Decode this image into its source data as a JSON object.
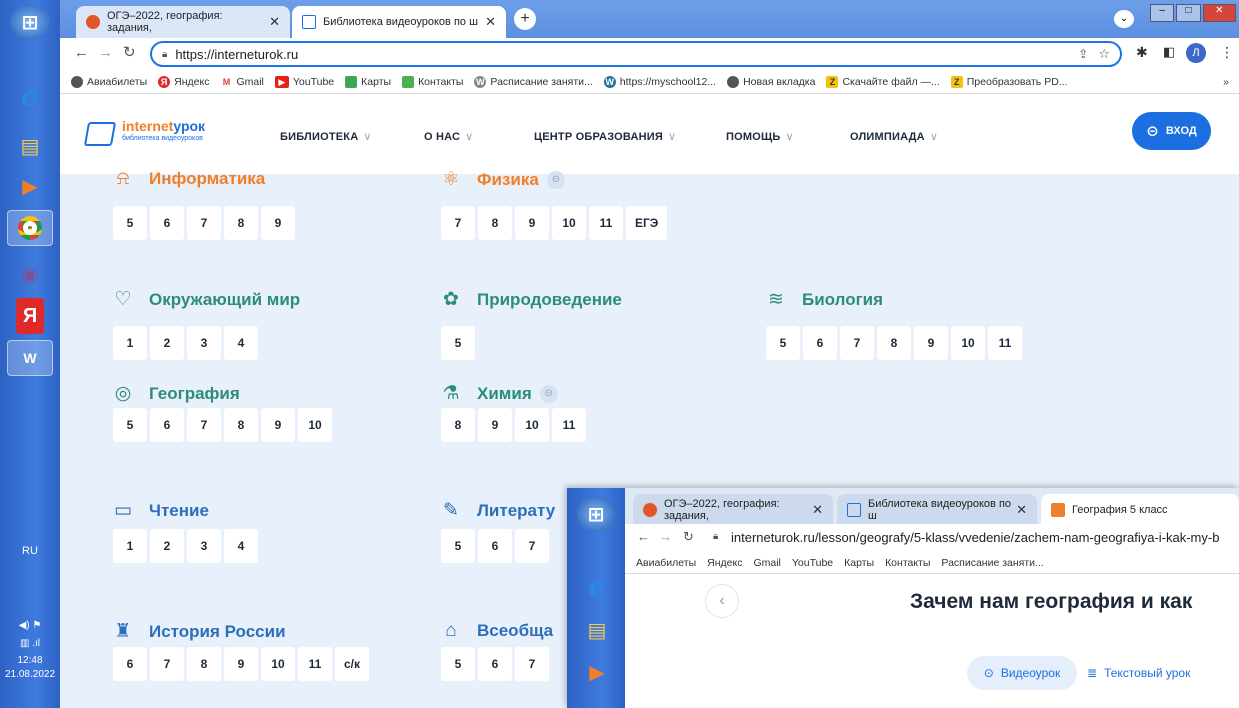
{
  "taskbar": {
    "lang": "RU",
    "time": "12:48",
    "date": "21.08.2022"
  },
  "browser": {
    "tabs": [
      {
        "title": "ОГЭ–2022, география: задания, ",
        "close": "✕"
      },
      {
        "title": "Библиотека видеоуроков по ш",
        "close": "✕"
      }
    ],
    "new_tab": "+",
    "url": "https://interneturok.ru",
    "avatar": "Л",
    "bookmarks": [
      "Авиабилеты",
      "Яндекс",
      "Gmail",
      "YouTube",
      "Карты",
      "Контакты",
      "Расписание заняти...",
      "https://myschool12...",
      "Новая вкладка",
      "Скачайте файл —...",
      "Преобразовать PD..."
    ],
    "more": "»"
  },
  "site": {
    "logo_main": "internet",
    "logo_accent": "урок",
    "logo_sub": "библиотека видеоуроков",
    "nav": [
      "БИБЛИОТЕКА",
      "О НАС",
      "ЦЕНТР ОБРАЗОВАНИЯ",
      "ПОМОЩЬ",
      "ОЛИМПИАДА"
    ],
    "login": "ВХОД"
  },
  "subjects": [
    {
      "name": "Информатика",
      "color": "#f07f2a",
      "icon": "mouse-icon",
      "grades": [
        "5",
        "6",
        "7",
        "8",
        "9"
      ]
    },
    {
      "name": "Физика",
      "color": "#f07f2a",
      "icon": "atom-icon",
      "locked": true,
      "grades": [
        "7",
        "8",
        "9",
        "10",
        "11",
        "ЕГЭ"
      ]
    },
    {
      "name": "Окружающий мир",
      "color": "#2c8c7a",
      "icon": "bird-icon",
      "grades": [
        "1",
        "2",
        "3",
        "4"
      ]
    },
    {
      "name": "Природоведение",
      "color": "#2c8c7a",
      "icon": "flower-icon",
      "grades": [
        "5"
      ]
    },
    {
      "name": "Биология",
      "color": "#2c8c7a",
      "icon": "dna-icon",
      "grades": [
        "5",
        "6",
        "7",
        "8",
        "9",
        "10",
        "11"
      ]
    },
    {
      "name": "География",
      "color": "#2c8c7a",
      "icon": "globe-icon",
      "grades": [
        "5",
        "6",
        "7",
        "8",
        "9",
        "10"
      ]
    },
    {
      "name": "Химия",
      "color": "#2c8c7a",
      "icon": "flask-icon",
      "locked": true,
      "grades": [
        "8",
        "9",
        "10",
        "11"
      ]
    },
    {
      "name": "Чтение",
      "color": "#2c6fb8",
      "icon": "book-icon",
      "grades": [
        "1",
        "2",
        "3",
        "4"
      ]
    },
    {
      "name": "Литерату",
      "color": "#2c6fb8",
      "icon": "quill-icon",
      "grades": [
        "5",
        "6",
        "7"
      ]
    },
    {
      "name": "История России",
      "color": "#2c6fb8",
      "icon": "church-icon",
      "grades": [
        "6",
        "7",
        "8",
        "9",
        "10",
        "11",
        "с/к"
      ]
    },
    {
      "name": "Всеобща",
      "color": "#2c6fb8",
      "icon": "museum-icon",
      "grades": [
        "5",
        "6",
        "7"
      ]
    }
  ],
  "window2": {
    "tabs": [
      "ОГЭ–2022, география: задания, ",
      "Библиотека видеоуроков по ш",
      "География 5 класс"
    ],
    "url": "interneturok.ru/lesson/geografy/5-klass/vvedenie/zachem-nam-geografiya-i-kak-my-b",
    "bookmarks": [
      "Авиабилеты",
      "Яндекс",
      "Gmail",
      "YouTube",
      "Карты",
      "Контакты",
      "Расписание заняти..."
    ],
    "heading": "Зачем нам география и как",
    "btn_video": "Видеоурок",
    "btn_text": "Текстовый урок"
  }
}
